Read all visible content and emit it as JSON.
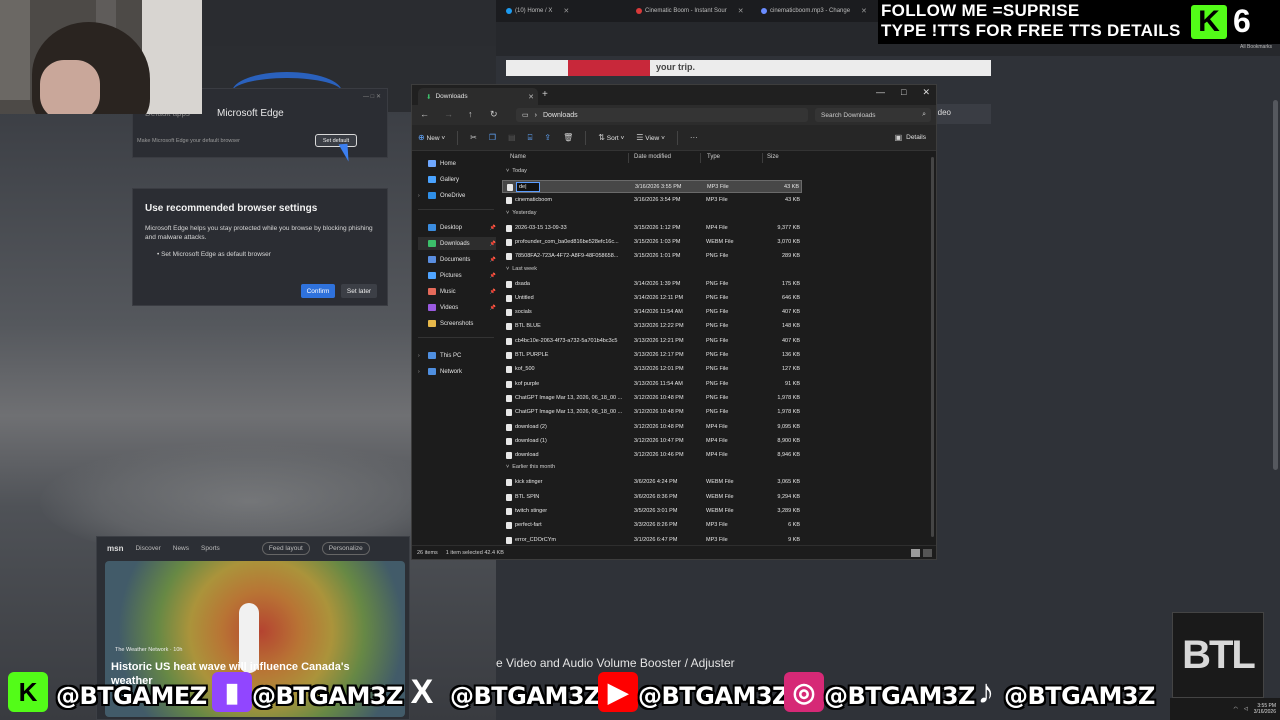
{
  "browser_tabs": [
    {
      "label": "(10) Home / X",
      "color": "#1d9bf0"
    },
    {
      "label": "Cinematic Boom - Instant Sour",
      "color": "#d93a3a"
    },
    {
      "label": "cinematicboom.mp3 - Change",
      "color": "#6a8cff"
    }
  ],
  "bookmarks_label": "All Bookmarks",
  "bg_page": {
    "banner_text": "your trip.",
    "search_strip_text": "deo",
    "footer_title": "e Video and Audio Volume Booster / Adjuster"
  },
  "edge_setup": {
    "faint_label": "Default apps",
    "app_title": "Microsoft Edge",
    "make_default_text": "Make Microsoft Edge your default browser",
    "set_default_button": "Set default",
    "card_title": "Use recommended browser settings",
    "card_desc": "Microsoft Edge helps you stay protected while you browse by blocking phishing and malware attacks.",
    "bullet": "Set Microsoft Edge as default browser",
    "confirm": "Confirm",
    "later": "Set later"
  },
  "msn": {
    "brand": "msn",
    "tabs": [
      "Discover",
      "News",
      "Sports"
    ],
    "feed_layout": "Feed layout",
    "personalize": "Personalize",
    "source": "The Weather Network · 10h",
    "headline": "Historic US heat wave will influence Canada's weather"
  },
  "explorer": {
    "tab_title": "Downloads",
    "path": "Downloads",
    "search_placeholder": "Search Downloads",
    "cmd": {
      "new": "New",
      "sort": "Sort",
      "view": "View",
      "details": "Details"
    },
    "nav": [
      {
        "label": "Home",
        "color": "#6fa8ff"
      },
      {
        "label": "Gallery",
        "color": "#4aa3ff"
      },
      {
        "label": "OneDrive",
        "color": "#2f8fe8"
      },
      {
        "label": "Desktop",
        "color": "#3b8de0"
      },
      {
        "label": "Downloads",
        "color": "#3cbf6a"
      },
      {
        "label": "Documents",
        "color": "#5a8ee0"
      },
      {
        "label": "Pictures",
        "color": "#4fa4ff"
      },
      {
        "label": "Music",
        "color": "#e56a5a"
      },
      {
        "label": "Videos",
        "color": "#9a5ae0"
      },
      {
        "label": "Screenshots",
        "color": "#e7b84a"
      },
      {
        "label": "This PC",
        "color": "#4f8fe0"
      },
      {
        "label": "Network",
        "color": "#4f8fe0"
      }
    ],
    "columns": [
      "Name",
      "Date modified",
      "Type",
      "Size"
    ],
    "groups": [
      {
        "label": "Today",
        "files": [
          {
            "name": "de|",
            "date": "3/16/2026 3:55 PM",
            "type": "MP3 File",
            "size": "43 KB",
            "selected": true
          },
          {
            "name": "cinematicboom",
            "date": "3/16/2026 3:54 PM",
            "type": "MP3 File",
            "size": "43 KB"
          }
        ]
      },
      {
        "label": "Yesterday",
        "files": [
          {
            "name": "2026-03-15 13-09-33",
            "date": "3/15/2026 1:12 PM",
            "type": "MP4 File",
            "size": "9,377 KB"
          },
          {
            "name": "profounder_com_ba0ed816be528efc16c...",
            "date": "3/15/2026 1:03 PM",
            "type": "WEBM File",
            "size": "3,070 KB"
          },
          {
            "name": "78508FA2-723A-4F72-A8F9-48F058658...",
            "date": "3/15/2026 1:01 PM",
            "type": "PNG File",
            "size": "289 KB"
          }
        ]
      },
      {
        "label": "Last week",
        "files": [
          {
            "name": "dsada",
            "date": "3/14/2026 1:39 PM",
            "type": "PNG File",
            "size": "175 KB"
          },
          {
            "name": "Untitled",
            "date": "3/14/2026 12:11 PM",
            "type": "PNG File",
            "size": "646 KB"
          },
          {
            "name": "socials",
            "date": "3/14/2026 11:54 AM",
            "type": "PNG File",
            "size": "407 KB"
          },
          {
            "name": "BTL BLUE",
            "date": "3/13/2026 12:22 PM",
            "type": "PNG File",
            "size": "148 KB"
          },
          {
            "name": "cb4bc10e-2063-4f73-a732-5a701b4bc3c5",
            "date": "3/13/2026 12:21 PM",
            "type": "PNG File",
            "size": "407 KB"
          },
          {
            "name": "BTL PURPLE",
            "date": "3/13/2026 12:17 PM",
            "type": "PNG File",
            "size": "136 KB"
          },
          {
            "name": "kof_500",
            "date": "3/13/2026 12:01 PM",
            "type": "PNG File",
            "size": "127 KB"
          },
          {
            "name": "kof purple",
            "date": "3/13/2026 11:54 AM",
            "type": "PNG File",
            "size": "91 KB"
          },
          {
            "name": "ChatGPT Image Mar 13, 2026, 06_18_00 ...",
            "date": "3/12/2026 10:48 PM",
            "type": "PNG File",
            "size": "1,978 KB"
          },
          {
            "name": "ChatGPT Image Mar 13, 2026, 06_18_00 ...",
            "date": "3/12/2026 10:48 PM",
            "type": "PNG File",
            "size": "1,978 KB"
          },
          {
            "name": "download (2)",
            "date": "3/12/2026 10:48 PM",
            "type": "MP4 File",
            "size": "9,095 KB"
          },
          {
            "name": "download (1)",
            "date": "3/12/2026 10:47 PM",
            "type": "MP4 File",
            "size": "8,900 KB"
          },
          {
            "name": "download",
            "date": "3/12/2026 10:46 PM",
            "type": "MP4 File",
            "size": "8,946 KB"
          }
        ]
      },
      {
        "label": "Earlier this month",
        "files": [
          {
            "name": "kick stinger",
            "date": "3/6/2026 4:24 PM",
            "type": "WEBM File",
            "size": "3,065 KB"
          },
          {
            "name": "BTL SPIN",
            "date": "3/6/2026 8:36 PM",
            "type": "WEBM File",
            "size": "9,294 KB"
          },
          {
            "name": "twitch stinger",
            "date": "3/5/2026 3:01 PM",
            "type": "WEBM File",
            "size": "3,289 KB"
          },
          {
            "name": "perfect-fart",
            "date": "3/3/2026 8:26 PM",
            "type": "MP3 File",
            "size": "6 KB"
          },
          {
            "name": "error_CDOrCYm",
            "date": "3/1/2026 6:47 PM",
            "type": "MP3 File",
            "size": "9 KB"
          }
        ]
      }
    ],
    "status_items": "26 items",
    "status_selected": "1 item selected  42.4 KB"
  },
  "overlay": {
    "follow_line1": "FOLLOW ME =SUPRISE",
    "follow_line2": "TYPE !TTS FOR FREE TTS DETAILS",
    "kick_letter": "K",
    "count": "6",
    "btl_logo": "BTL",
    "socials": [
      {
        "platform": "kick",
        "glyph": "K",
        "handle": "@BTGAMEZ",
        "color": "#53fc18"
      },
      {
        "platform": "twitch",
        "glyph": "▮",
        "handle": "@BTGAM3Z",
        "color": "#9146ff"
      },
      {
        "platform": "x",
        "glyph": "X",
        "handle": "@BTGAM3Z",
        "color": "#000000"
      },
      {
        "platform": "youtube",
        "glyph": "▶",
        "handle": "@BTGAM3Z",
        "color": "#ff0000"
      },
      {
        "platform": "instagram",
        "glyph": "◎",
        "handle": "@BTGAM3Z",
        "color": "#d62976"
      },
      {
        "platform": "tiktok",
        "glyph": "♪",
        "handle": "@BTGAM3Z",
        "color": "#000000"
      }
    ]
  },
  "taskbar": {
    "time": "3:55 PM",
    "date": "3/16/2026"
  }
}
